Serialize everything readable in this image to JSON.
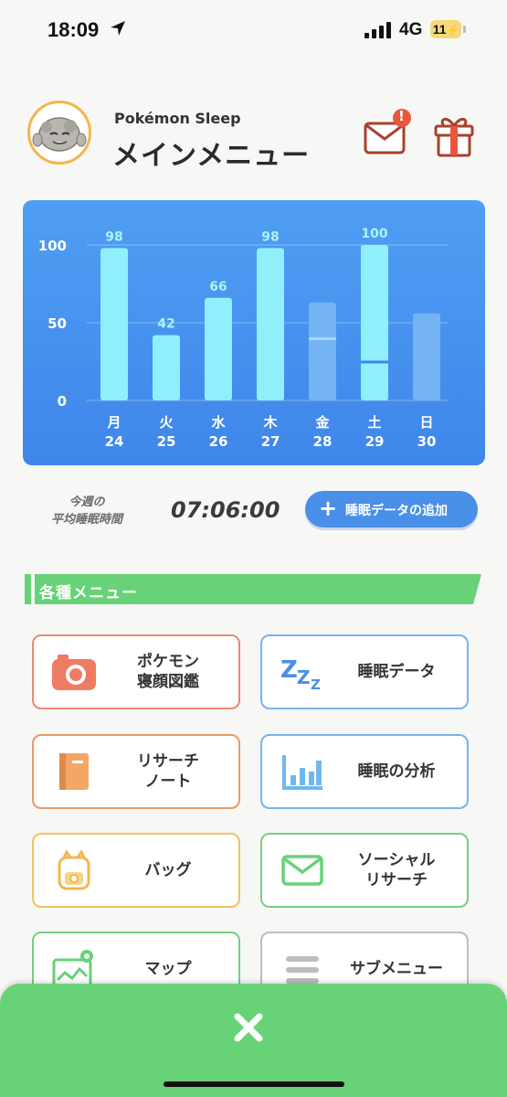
{
  "status_bar": {
    "time": "18:09",
    "network": "4G",
    "battery": "11"
  },
  "header": {
    "app_name": "Pokémon Sleep",
    "title": "メインメニュー",
    "avatar_icon": "graveler-avatar-icon",
    "mail_icon": "mail-icon",
    "gift_icon": "gift-icon",
    "mail_badge": "!"
  },
  "chart_data": {
    "type": "bar",
    "categories": [
      "月 24",
      "火 25",
      "水 26",
      "木 27",
      "金 28",
      "土 29",
      "日 30"
    ],
    "day_labels": [
      "月",
      "火",
      "水",
      "木",
      "金",
      "土",
      "日"
    ],
    "date_labels": [
      "24",
      "25",
      "26",
      "27",
      "28",
      "29",
      "30"
    ],
    "values": [
      98,
      42,
      66,
      98,
      63,
      100,
      56
    ],
    "value_labels": [
      "98",
      "42",
      "66",
      "98",
      "",
      "100",
      ""
    ],
    "secondary_marks": [
      null,
      null,
      null,
      null,
      40,
      25,
      null
    ],
    "faded": [
      false,
      false,
      false,
      false,
      true,
      false,
      true
    ],
    "yticks": [
      "100",
      "50",
      "0"
    ],
    "ylim": [
      0,
      100
    ],
    "grid": true,
    "colors": {
      "bar": "#8ff0fb",
      "bar_faded": "#74b4f3",
      "label": "#aef3fb",
      "axis_text": "#ffffff"
    }
  },
  "stats": {
    "avg_label": "今週の\n平均睡眠時間",
    "avg_value": "07:06:00",
    "add_button": "睡眠データの追加"
  },
  "section": {
    "title": "各種メニュー",
    "color": "#67d277"
  },
  "menu": [
    {
      "label": "ポケモン\n寝顔図鑑",
      "icon": "camera-icon",
      "border": "#ea8a72"
    },
    {
      "label": "睡眠データ",
      "icon": "zzz-icon",
      "border": "#7ab3ea"
    },
    {
      "label": "リサーチ\nノート",
      "icon": "notebook-icon",
      "border": "#ea9a66"
    },
    {
      "label": "睡眠の分析",
      "icon": "bar-chart-icon",
      "border": "#7ab3ea"
    },
    {
      "label": "バッグ",
      "icon": "bag-icon",
      "border": "#f1c35c"
    },
    {
      "label": "ソーシャル\nリサーチ",
      "icon": "envelope-icon",
      "border": "#75cf83"
    },
    {
      "label": "マップ",
      "icon": "map-icon",
      "border": "#75cf83"
    },
    {
      "label": "サブメニュー",
      "icon": "hamburger-icon",
      "border": "#bdbdbd"
    }
  ],
  "bottom": {
    "close_icon": "close-icon"
  }
}
